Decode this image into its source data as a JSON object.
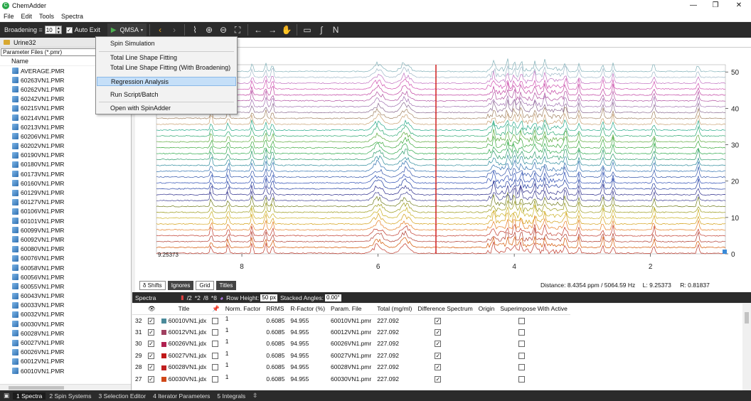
{
  "window": {
    "title": "ChemAdder",
    "controls": [
      "—",
      "❐",
      "✕"
    ]
  },
  "menubar": [
    "File",
    "Edit",
    "Tools",
    "Spectra"
  ],
  "toolbar": {
    "broadening_label": "Broadening =",
    "broadening_value": "10",
    "auto_exit_label": "Auto Exit",
    "auto_exit_checked": "✓",
    "qmsa_label": "QMSA"
  },
  "dropdown": {
    "items": [
      "Spin Simulation",
      "Total Line Shape Fitting",
      "Total Line Shape Fitting (With Broadening)",
      "Regression Analysis",
      "Run Script/Batch",
      "Open with SpinAdder"
    ],
    "highlighted": "Regression Analysis"
  },
  "left_panel": {
    "folder_name": "Urine32",
    "filter_value": "Parameter Files (*.pmr)",
    "column_header": "Name",
    "files": [
      "AVERAGE.PMR",
      "60263VN1.PMR",
      "60262VN1.PMR",
      "60242VN1.PMR",
      "60215VN1.PMR",
      "60214VN1.PMR",
      "60213VN1.PMR",
      "60206VN1.PMR",
      "60202VN1.PMR",
      "60190VN1.PMR",
      "60180VN1.PMR",
      "60173VN1.PMR",
      "60160VN1.PMR",
      "60129VN1.PMR",
      "60127VN1.PMR",
      "60106VN1.PMR",
      "60101VN1.PMR",
      "60099VN1.PMR",
      "60092VN1.PMR",
      "60080VN1.PMR",
      "60076VN1.PMR",
      "60058VN1.PMR",
      "60056VN1.PMR",
      "60055VN1.PMR",
      "60043VN1.PMR",
      "60033VN1.PMR",
      "60032VN1.PMR",
      "60030VN1.PMR",
      "60028VN1.PMR",
      "60027VN1.PMR",
      "60026VN1.PMR",
      "60012VN1.PMR",
      "60010VN1.PMR"
    ]
  },
  "chart_data": {
    "type": "line",
    "xlabel": "",
    "ylabel": "",
    "x_ticks": [
      "8",
      "6",
      "4",
      "2"
    ],
    "x_tick_values": [
      8,
      6,
      4,
      2
    ],
    "x_range": [
      9.25373,
      0.9
    ],
    "x_reversed": true,
    "y_ticks": [
      "50",
      "40",
      "30",
      "20",
      "10",
      "0"
    ],
    "y_tick_values": [
      50,
      40,
      30,
      20,
      10,
      0
    ],
    "y_range": [
      0,
      52
    ],
    "y_axis_side": "right",
    "corner_label": "9.25373",
    "series_count": 32,
    "series_colors": [
      "#c0392b",
      "#d35400",
      "#b03a2e",
      "#c0392b",
      "#e67e22",
      "#d4a017",
      "#c9b020",
      "#9a9a1a",
      "#6e7a1a",
      "#3c3c90",
      "#2a2a8a",
      "#1f3ba0",
      "#2b4cb3",
      "#3355aa",
      "#2e6fae",
      "#2b8a9a",
      "#2a9a6a",
      "#2ea84a",
      "#3aa83a",
      "#5aa83a",
      "#2aa870",
      "#24a888",
      "#c8a070",
      "#a08060",
      "#8a6a90",
      "#a070b0",
      "#b050a0",
      "#c040a0",
      "#d050b0",
      "#c070c0",
      "#a0b8c8",
      "#80b0b8"
    ],
    "peak_positions_ppm": [
      8.45,
      8.2,
      7.85,
      7.65,
      7.55,
      6.0,
      5.6,
      4.3,
      4.1,
      4.0,
      3.9,
      3.7,
      3.55,
      3.25,
      3.05,
      2.7,
      2.55,
      1.95,
      1.3
    ],
    "red_marker_ppm": 5.15,
    "grid": false,
    "legend": "none"
  },
  "chart_tools": {
    "shifts_btn": "δ Shifts",
    "ignores_btn": "Ignores",
    "grid_btn": "Grid",
    "titles_btn": "Titles",
    "distance_label": "Distance:",
    "distance_value": "8.4354 ppm / 5064.59 Hz",
    "l_label": "L:",
    "l_value": "9.25373",
    "r_label": "R:",
    "r_value": "0.81837"
  },
  "spectra_panel": {
    "title": "Spectra",
    "ops": [
      "/2",
      "*2",
      "/8",
      "*8"
    ],
    "row_height_label": "Row Height:",
    "row_height_value": "50 px",
    "stacked_angles_label": "Stacked Angles:",
    "stacked_angles_value": "0.00°",
    "columns": [
      "",
      "",
      "Title",
      "",
      "Norm. Factor",
      "RRMS",
      "R-Factor (%)",
      "Param. File",
      "Total (mg/ml)",
      "Difference Spectrum",
      "Origin",
      "Superimpose With Active"
    ],
    "rows": [
      {
        "idx": "32",
        "color": "#4a8a9a",
        "title": "60010VN1.jdx",
        "norm": "1",
        "rrms": "0.6085",
        "rfactor": "94.955",
        "param": "60010VN1.pmr",
        "total": "227.092",
        "diff": "✓"
      },
      {
        "idx": "31",
        "color": "#a04060",
        "title": "60012VN1.jdx",
        "norm": "1",
        "rrms": "0.6085",
        "rfactor": "94.955",
        "param": "60012VN1.pmr",
        "total": "227.092",
        "diff": "✓"
      },
      {
        "idx": "30",
        "color": "#b02050",
        "title": "60026VN1.jdx",
        "norm": "1",
        "rrms": "0.6085",
        "rfactor": "94.955",
        "param": "60026VN1.pmr",
        "total": "227.092",
        "diff": "✓"
      },
      {
        "idx": "29",
        "color": "#c01818",
        "title": "60027VN1.jdx",
        "norm": "1",
        "rrms": "0.6085",
        "rfactor": "94.955",
        "param": "60027VN1.pmr",
        "total": "227.092",
        "diff": "✓"
      },
      {
        "idx": "28",
        "color": "#c02020",
        "title": "60028VN1.jdx",
        "norm": "1",
        "rrms": "0.6085",
        "rfactor": "94.955",
        "param": "60028VN1.pmr",
        "total": "227.092",
        "diff": "✓"
      },
      {
        "idx": "27",
        "color": "#d04818",
        "title": "60030VN1.jdx",
        "norm": "1",
        "rrms": "0.6085",
        "rfactor": "94.955",
        "param": "60030VN1.pmr",
        "total": "227.092",
        "diff": "✓"
      }
    ]
  },
  "statusbar": {
    "tabs": [
      "1 Spectra",
      "2 Spin Systems",
      "3 Selection Editor",
      "4 Iterator Parameters",
      "5 Integrals"
    ],
    "active": "1 Spectra"
  }
}
